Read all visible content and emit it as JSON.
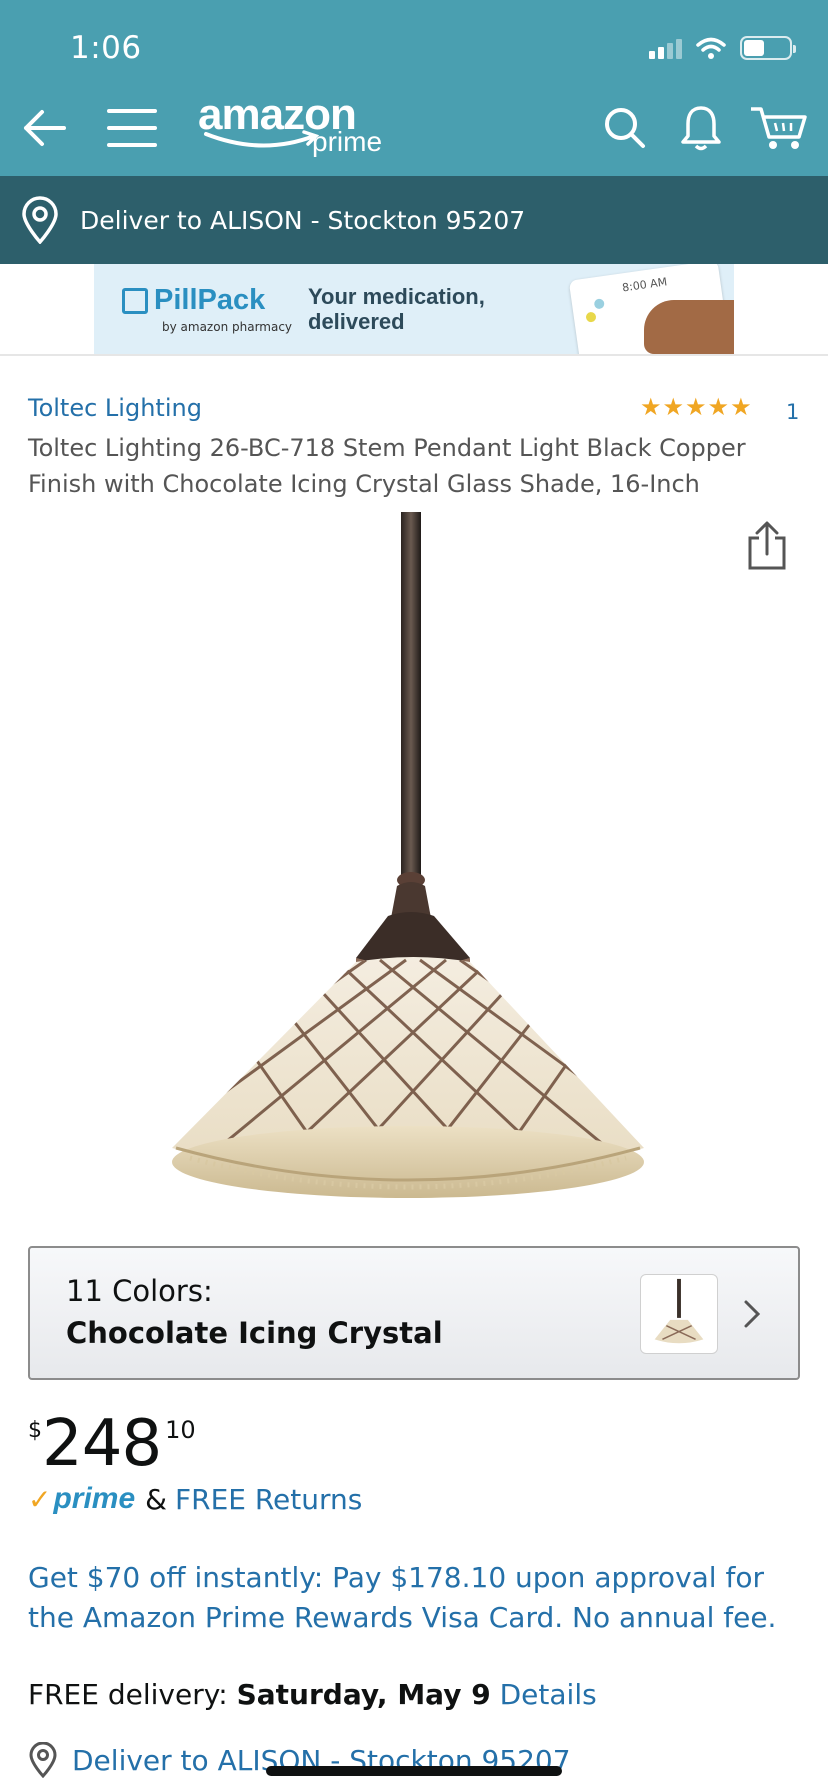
{
  "status_bar": {
    "time": "1:06",
    "battery_level": 0.45
  },
  "header": {
    "logo_text": "amazon",
    "logo_subtext": "prime",
    "icons": [
      "back-arrow-icon",
      "menu-icon",
      "search-icon",
      "bell-icon",
      "cart-icon"
    ]
  },
  "deliver_bar": {
    "text": "Deliver to ALISON - Stockton 95207"
  },
  "ad": {
    "brand": "PillPack",
    "byline": "by amazon pharmacy",
    "tagline_line1": "Your medication,",
    "tagline_line2": "delivered",
    "card_time": "8:00 AM"
  },
  "product": {
    "brand": "Toltec Lighting",
    "rating_stars": 5,
    "review_count": "1",
    "title": "Toltec Lighting 26-BC-718 Stem Pendant Light Black Copper Finish with Chocolate Icing Crystal Glass Shade, 16-Inch"
  },
  "color_selector": {
    "count_label": "11 Colors:",
    "selected": "Chocolate Icing Crystal"
  },
  "price": {
    "symbol": "$",
    "whole": "248",
    "fraction": "10"
  },
  "prime_row": {
    "check": "✓",
    "badge": "prime",
    "amp": "&",
    "returns": "FREE Returns"
  },
  "offer": {
    "text": "Get $70 off instantly: Pay $178.10 upon approval for the Amazon Prime Rewards Visa Card. No annual fee."
  },
  "delivery": {
    "prefix": "FREE delivery:",
    "date": "Saturday, May 9",
    "details": "Details"
  },
  "deliver_link": {
    "text": "Deliver to ALISON - Stockton 95207"
  },
  "colors": {
    "header_bg": "#4a9fb0",
    "deliver_bar_bg": "#2d5f6b",
    "link": "#2470a9",
    "star": "#f0a623",
    "prime_blue": "#2a8fc1"
  }
}
